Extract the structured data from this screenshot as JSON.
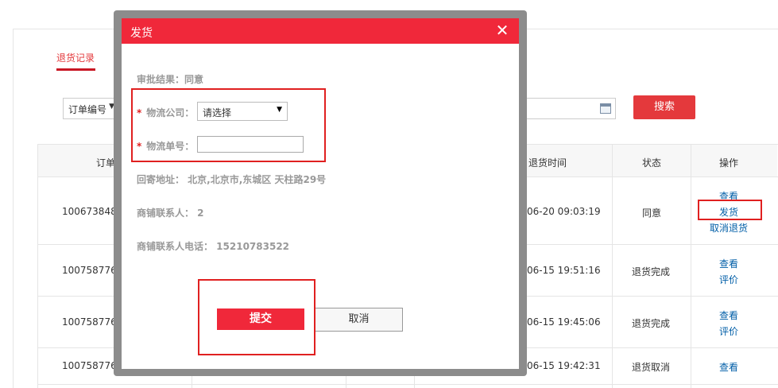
{
  "tab": {
    "label": "退货记录"
  },
  "filter": {
    "type_label": "订单编号",
    "search_label": "搜索"
  },
  "table": {
    "headers": {
      "order": "订单",
      "return_time": "退货时间",
      "status": "状态",
      "actions": "操作"
    },
    "rows": [
      {
        "order": "100673848",
        "time": "06-20 09:03:19",
        "status": "同意",
        "links": [
          "查看",
          "发货",
          "取消退货"
        ]
      },
      {
        "order": "100758776",
        "time": "06-15 19:51:16",
        "status": "退货完成",
        "links": [
          "查看",
          "评价"
        ]
      },
      {
        "order": "100758776",
        "time": "06-15 19:45:06",
        "status": "退货完成",
        "links": [
          "查看",
          "评价"
        ]
      },
      {
        "order": "100758776",
        "time": "06-15 19:42:31",
        "status": "退货取消",
        "links": [
          "查看"
        ]
      }
    ]
  },
  "modal": {
    "title": "发货",
    "close": "✕",
    "approval": "审批结果：同意",
    "company_label": "物流公司：",
    "company_value": "请选择",
    "tracking_label": "物流单号：",
    "tracking_value": "",
    "address": "回寄地址： 北京,北京市,东城区 天柱路29号",
    "contact": "商铺联系人： 2",
    "phone": "商铺联系人电话： 15210783522",
    "submit": "提交",
    "cancel": "取消"
  },
  "colors": {
    "accent": "#f0283a",
    "link": "#005ea7",
    "highlight": "#e02020"
  }
}
